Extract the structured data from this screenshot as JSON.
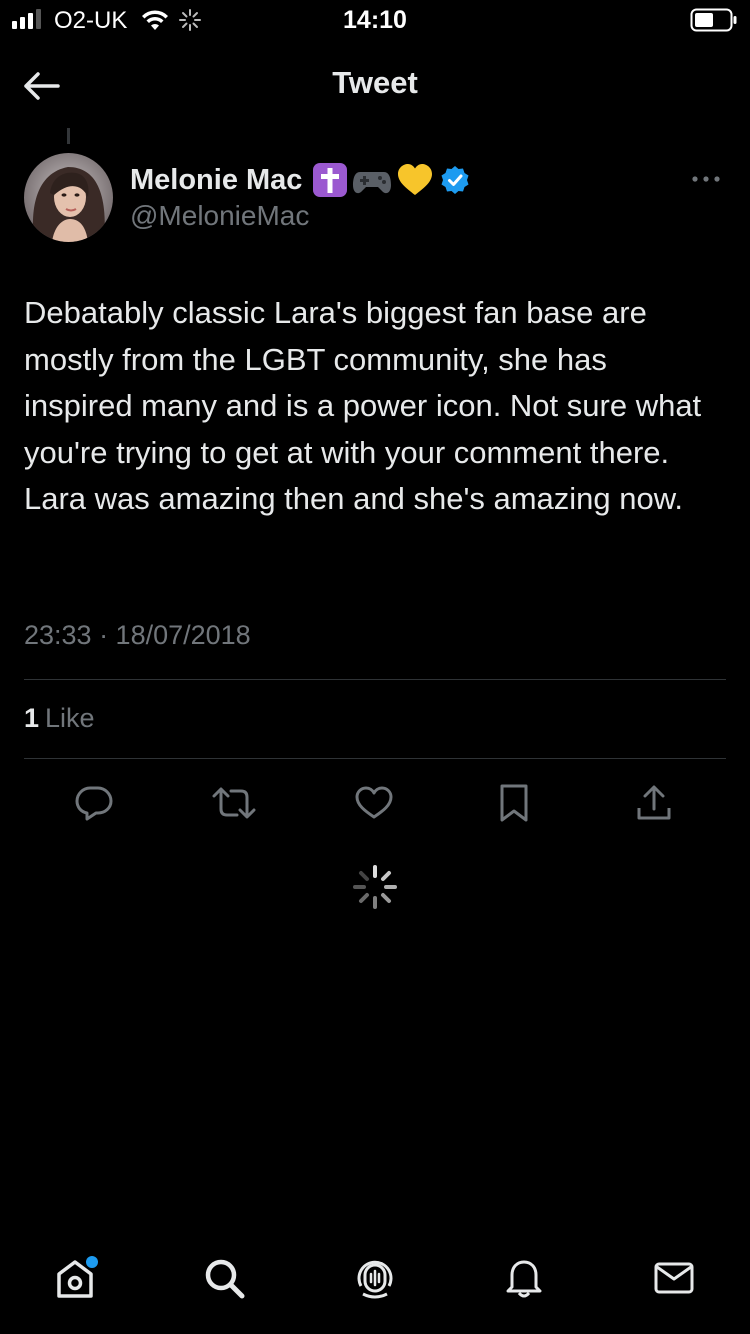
{
  "status_bar": {
    "carrier": "O2-UK",
    "time": "14:10",
    "icons": [
      "signal-icon",
      "wifi-icon",
      "activity-icon",
      "battery-icon"
    ]
  },
  "header": {
    "back_icon": "arrow-left-icon",
    "title": "Tweet"
  },
  "tweet": {
    "author": {
      "display_name": "Melonie Mac",
      "badges": [
        "latin-cross-emoji",
        "game-controller-emoji",
        "yellow-heart-emoji"
      ],
      "verified": true,
      "handle": "@MelonieMac"
    },
    "text": "Debatably classic Lara's biggest fan base are mostly from the LGBT community, she has inspired many and is a power icon. Not sure what you're trying to get at with your comment there. Lara was amazing then and she's amazing now.",
    "timestamp": "23:33 · 18/07/2018",
    "likes": {
      "count": "1",
      "label": "Like"
    },
    "actions": [
      "reply-icon",
      "retweet-icon",
      "like-icon",
      "bookmark-icon",
      "share-icon"
    ]
  },
  "tab_bar": {
    "tabs": [
      "home-icon",
      "search-icon",
      "spaces-icon",
      "notifications-icon",
      "messages-icon"
    ]
  },
  "colors": {
    "background": "#000000",
    "primary_text": "#e7e9ea",
    "secondary_text": "#71767b",
    "divider": "#2f3336",
    "accent": "#1d9bf0"
  }
}
